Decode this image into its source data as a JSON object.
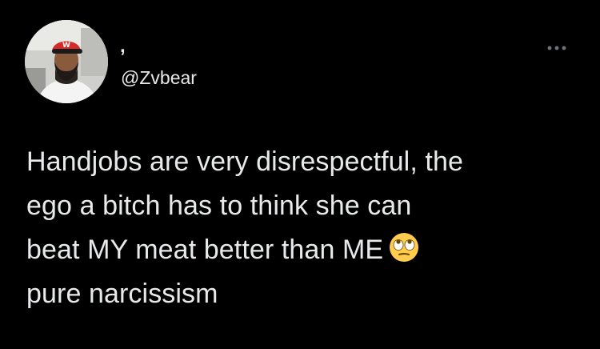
{
  "tweet": {
    "display_name": ",",
    "handle": "@Zvbear",
    "avatar_icon": "profile-photo-avatar",
    "more_icon": "more-options-icon",
    "lines": [
      "Handjobs are very disrespectful, the",
      "ego a bitch has to think she can",
      "beat MY meat better than ME",
      "pure narcissism"
    ],
    "emoji": "face-with-rolling-eyes-emoji"
  },
  "colors": {
    "background": "#000000",
    "text": "#e7e9ea",
    "muted": "#6e767d"
  }
}
